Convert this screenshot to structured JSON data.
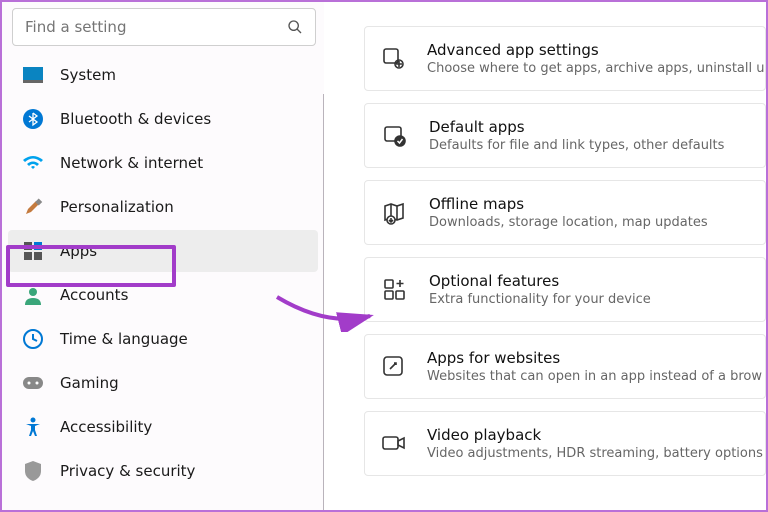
{
  "search": {
    "placeholder": "Find a setting"
  },
  "nav": {
    "system": "System",
    "bluetooth": "Bluetooth & devices",
    "network": "Network & internet",
    "personalization": "Personalization",
    "apps": "Apps",
    "accounts": "Accounts",
    "time": "Time & language",
    "gaming": "Gaming",
    "accessibility": "Accessibility",
    "privacy": "Privacy & security"
  },
  "cards": {
    "advanced": {
      "title": "Advanced app settings",
      "desc": "Choose where to get apps, archive apps, uninstall u"
    },
    "default": {
      "title": "Default apps",
      "desc": "Defaults for file and link types, other defaults"
    },
    "offline": {
      "title": "Offline maps",
      "desc": "Downloads, storage location, map updates"
    },
    "optional": {
      "title": "Optional features",
      "desc": "Extra functionality for your device"
    },
    "websites": {
      "title": "Apps for websites",
      "desc": "Websites that can open in an app instead of a brow"
    },
    "video": {
      "title": "Video playback",
      "desc": "Video adjustments, HDR streaming, battery options"
    }
  },
  "annotation": {
    "highlight_color": "#a23cc9"
  }
}
